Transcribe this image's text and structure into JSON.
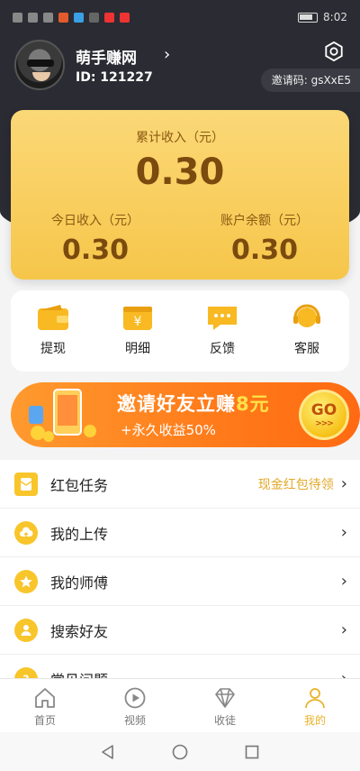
{
  "status_bar": {
    "time": "8:02"
  },
  "profile": {
    "name": "萌手赚网",
    "id_text": "ID: 121227",
    "invite_code": "邀请码: gsXxE5"
  },
  "earnings": {
    "total_label": "累计收入（元）",
    "total_value": "0.30",
    "today_label": "今日收入（元）",
    "today_value": "0.30",
    "balance_label": "账户余额（元）",
    "balance_value": "0.30"
  },
  "quick_actions": [
    {
      "label": "提现",
      "icon": "wallet-icon"
    },
    {
      "label": "明细",
      "icon": "calendar-yen-icon"
    },
    {
      "label": "反馈",
      "icon": "chat-bubble-icon"
    },
    {
      "label": "客服",
      "icon": "headset-icon"
    }
  ],
  "banner": {
    "title_main": "邀请好友立赚",
    "title_amount": "8元",
    "subtitle": "+永久收益50%",
    "go_label": "GO",
    "go_arrows": ">>>"
  },
  "menu": [
    {
      "label": "红包任务",
      "extra": "现金红包待领",
      "icon": "red-packet-icon"
    },
    {
      "label": "我的上传",
      "icon": "cloud-upload-icon"
    },
    {
      "label": "我的师傅",
      "icon": "star-icon"
    },
    {
      "label": "搜索好友",
      "icon": "person-icon"
    },
    {
      "label": "常见问题",
      "icon": "question-icon"
    }
  ],
  "bottom_nav": [
    {
      "label": "首页",
      "icon": "home-icon",
      "active": false
    },
    {
      "label": "视频",
      "icon": "play-icon",
      "active": false
    },
    {
      "label": "收徒",
      "icon": "diamond-icon",
      "active": false
    },
    {
      "label": "我的",
      "icon": "user-icon",
      "active": true
    }
  ],
  "colors": {
    "accent": "#f6c64a",
    "header_bg": "#2b2b33",
    "active_nav": "#e8b22a",
    "banner_orange": "#ff7a1a"
  }
}
